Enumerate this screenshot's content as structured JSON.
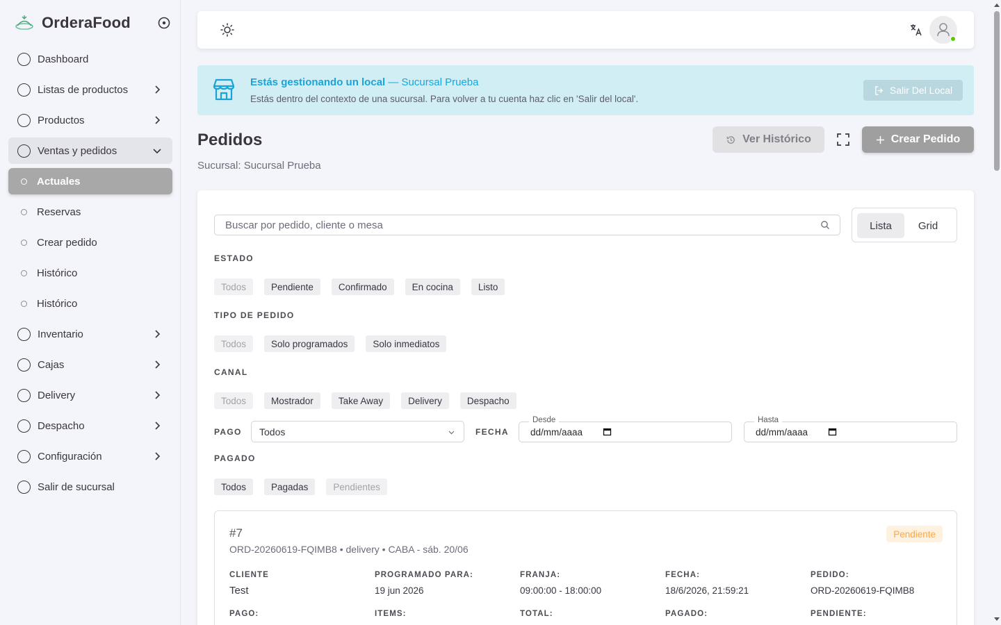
{
  "brand": {
    "name": "OrderaFood"
  },
  "sidebar": {
    "items": [
      {
        "label": "Dashboard",
        "kind": "top",
        "chevron": "none"
      },
      {
        "label": "Listas de productos",
        "kind": "top",
        "chevron": "right"
      },
      {
        "label": "Productos",
        "kind": "top",
        "chevron": "right"
      },
      {
        "label": "Ventas y pedidos",
        "kind": "top",
        "chevron": "down",
        "open": true
      },
      {
        "label": "Actuales",
        "kind": "sub",
        "chevron": "none",
        "active": true
      },
      {
        "label": "Reservas",
        "kind": "sub",
        "chevron": "none"
      },
      {
        "label": "Crear pedido",
        "kind": "sub",
        "chevron": "none"
      },
      {
        "label": "Histórico",
        "kind": "sub",
        "chevron": "none"
      },
      {
        "label": "Histórico",
        "kind": "sub",
        "chevron": "none"
      },
      {
        "label": "Inventario",
        "kind": "top",
        "chevron": "right"
      },
      {
        "label": "Cajas",
        "kind": "top",
        "chevron": "right"
      },
      {
        "label": "Delivery",
        "kind": "top",
        "chevron": "right"
      },
      {
        "label": "Despacho",
        "kind": "top",
        "chevron": "right"
      },
      {
        "label": "Configuración",
        "kind": "top",
        "chevron": "right"
      },
      {
        "label": "Salir de sucursal",
        "kind": "top",
        "chevron": "none"
      }
    ]
  },
  "alert": {
    "title": "Estás gestionando un local",
    "branch": "— Sucursal Prueba",
    "description": "Estás dentro del contexto de una sucursal. Para volver a tu cuenta haz clic en 'Salir del local'.",
    "exit_label": "Salir Del Local"
  },
  "page": {
    "title": "Pedidos",
    "subtitle": "Sucursal: Sucursal Prueba",
    "history_label": "Ver Histórico",
    "create_label": "Crear Pedido"
  },
  "search": {
    "placeholder": "Buscar por pedido, cliente o mesa"
  },
  "view_toggle": {
    "lista": "Lista",
    "grid": "Grid"
  },
  "filters": {
    "estado": {
      "label": "ESTADO",
      "options": [
        {
          "label": "Todos",
          "muted": true
        },
        {
          "label": "Pendiente"
        },
        {
          "label": "Confirmado"
        },
        {
          "label": "En cocina"
        },
        {
          "label": "Listo"
        }
      ]
    },
    "tipo": {
      "label": "TIPO DE PEDIDO",
      "options": [
        {
          "label": "Todos",
          "muted": true
        },
        {
          "label": "Solo programados"
        },
        {
          "label": "Solo inmediatos"
        }
      ]
    },
    "canal": {
      "label": "CANAL",
      "options": [
        {
          "label": "Todos",
          "muted": true
        },
        {
          "label": "Mostrador"
        },
        {
          "label": "Take Away"
        },
        {
          "label": "Delivery"
        },
        {
          "label": "Despacho"
        }
      ]
    },
    "pago": {
      "label": "PAGO",
      "value": "Todos"
    },
    "fecha": {
      "label": "FECHA",
      "desde_label": "Desde",
      "desde_value": "dd/mm/aaaa",
      "hasta_label": "Hasta",
      "hasta_value": "dd/mm/aaaa"
    },
    "pagado": {
      "label": "PAGADO",
      "options": [
        {
          "label": "Todos"
        },
        {
          "label": "Pagadas"
        },
        {
          "label": "Pendientes",
          "muted": true
        }
      ]
    }
  },
  "order": {
    "number": "#7",
    "meta": "ORD-20260619-FQIMB8 • delivery • CABA - sáb. 20/06",
    "status": "Pendiente",
    "fields": [
      {
        "label": "CLIENTE",
        "value": "Test",
        "big": true
      },
      {
        "label": "PROGRAMADO PARA:",
        "value": "19 jun 2026"
      },
      {
        "label": "FRANJA:",
        "value": "09:00:00 - 18:00:00"
      },
      {
        "label": "FECHA:",
        "value": "18/6/2026, 21:59:21"
      },
      {
        "label": "PEDIDO:",
        "value": "ORD-20260619-FQIMB8"
      },
      {
        "label": "PAGO:",
        "value": ""
      },
      {
        "label": "ITEMS:",
        "value": ""
      },
      {
        "label": "TOTAL:",
        "value": ""
      },
      {
        "label": "PAGADO:",
        "value": ""
      },
      {
        "label": "PENDIENTE:",
        "value": ""
      }
    ]
  },
  "colors": {
    "accent": "#16B1FF",
    "active_nav": "#A8A8A8",
    "pending": "#FFA83B"
  }
}
